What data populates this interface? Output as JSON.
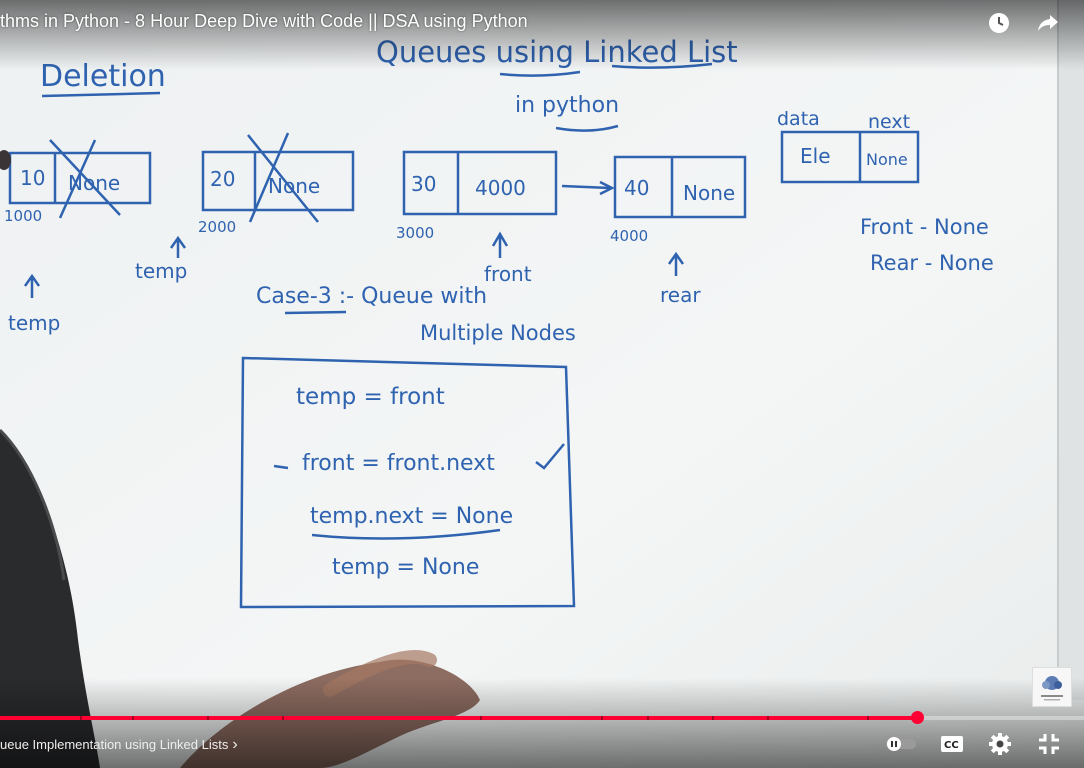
{
  "video": {
    "title": "thms in Python - 8 Hour Deep Dive with Code || DSA using Python",
    "chapter": "ueue Implementation using Linked Lists",
    "chapter_chevron": "›",
    "progress_fraction": 0.846,
    "chapter_fractions": [
      0.074,
      0.122,
      0.191,
      0.26,
      0.443,
      0.554,
      0.597,
      0.657,
      0.708,
      0.8
    ]
  },
  "whiteboard": {
    "heading_left": "Deletion",
    "title": "Queues using Linked List",
    "subtitle": "in python",
    "node1": {
      "data": "10",
      "next": "None",
      "address": "1000"
    },
    "node2": {
      "data": "20",
      "next": "None",
      "address": "2000"
    },
    "node3": {
      "data": "30",
      "next": "4000",
      "address": "3000"
    },
    "node4": {
      "data": "40",
      "next": "None",
      "address": "4000"
    },
    "legend": {
      "data_label": "data",
      "next_label": "next",
      "data_value": "Ele",
      "next_value": "None"
    },
    "temp_label_1": "temp",
    "temp_label_2": "temp",
    "front_label": "front",
    "rear_label": "rear",
    "front_status": "Front - None",
    "rear_status": "Rear - None",
    "case_title": "Case-3 :- Queue with",
    "case_subtitle": "Multiple Nodes",
    "code": [
      "temp = front",
      "front = front.next",
      "temp.next = None",
      "temp = None"
    ]
  },
  "icons": {
    "watch_later": "clock-icon",
    "share": "share-icon",
    "autoplay": "autoplay-toggle-icon",
    "captions": "cc-icon",
    "settings": "gear-icon",
    "fullscreen": "fullscreen-icon"
  },
  "colors": {
    "marker": "#2f63b0",
    "progress": "#ff0033"
  }
}
